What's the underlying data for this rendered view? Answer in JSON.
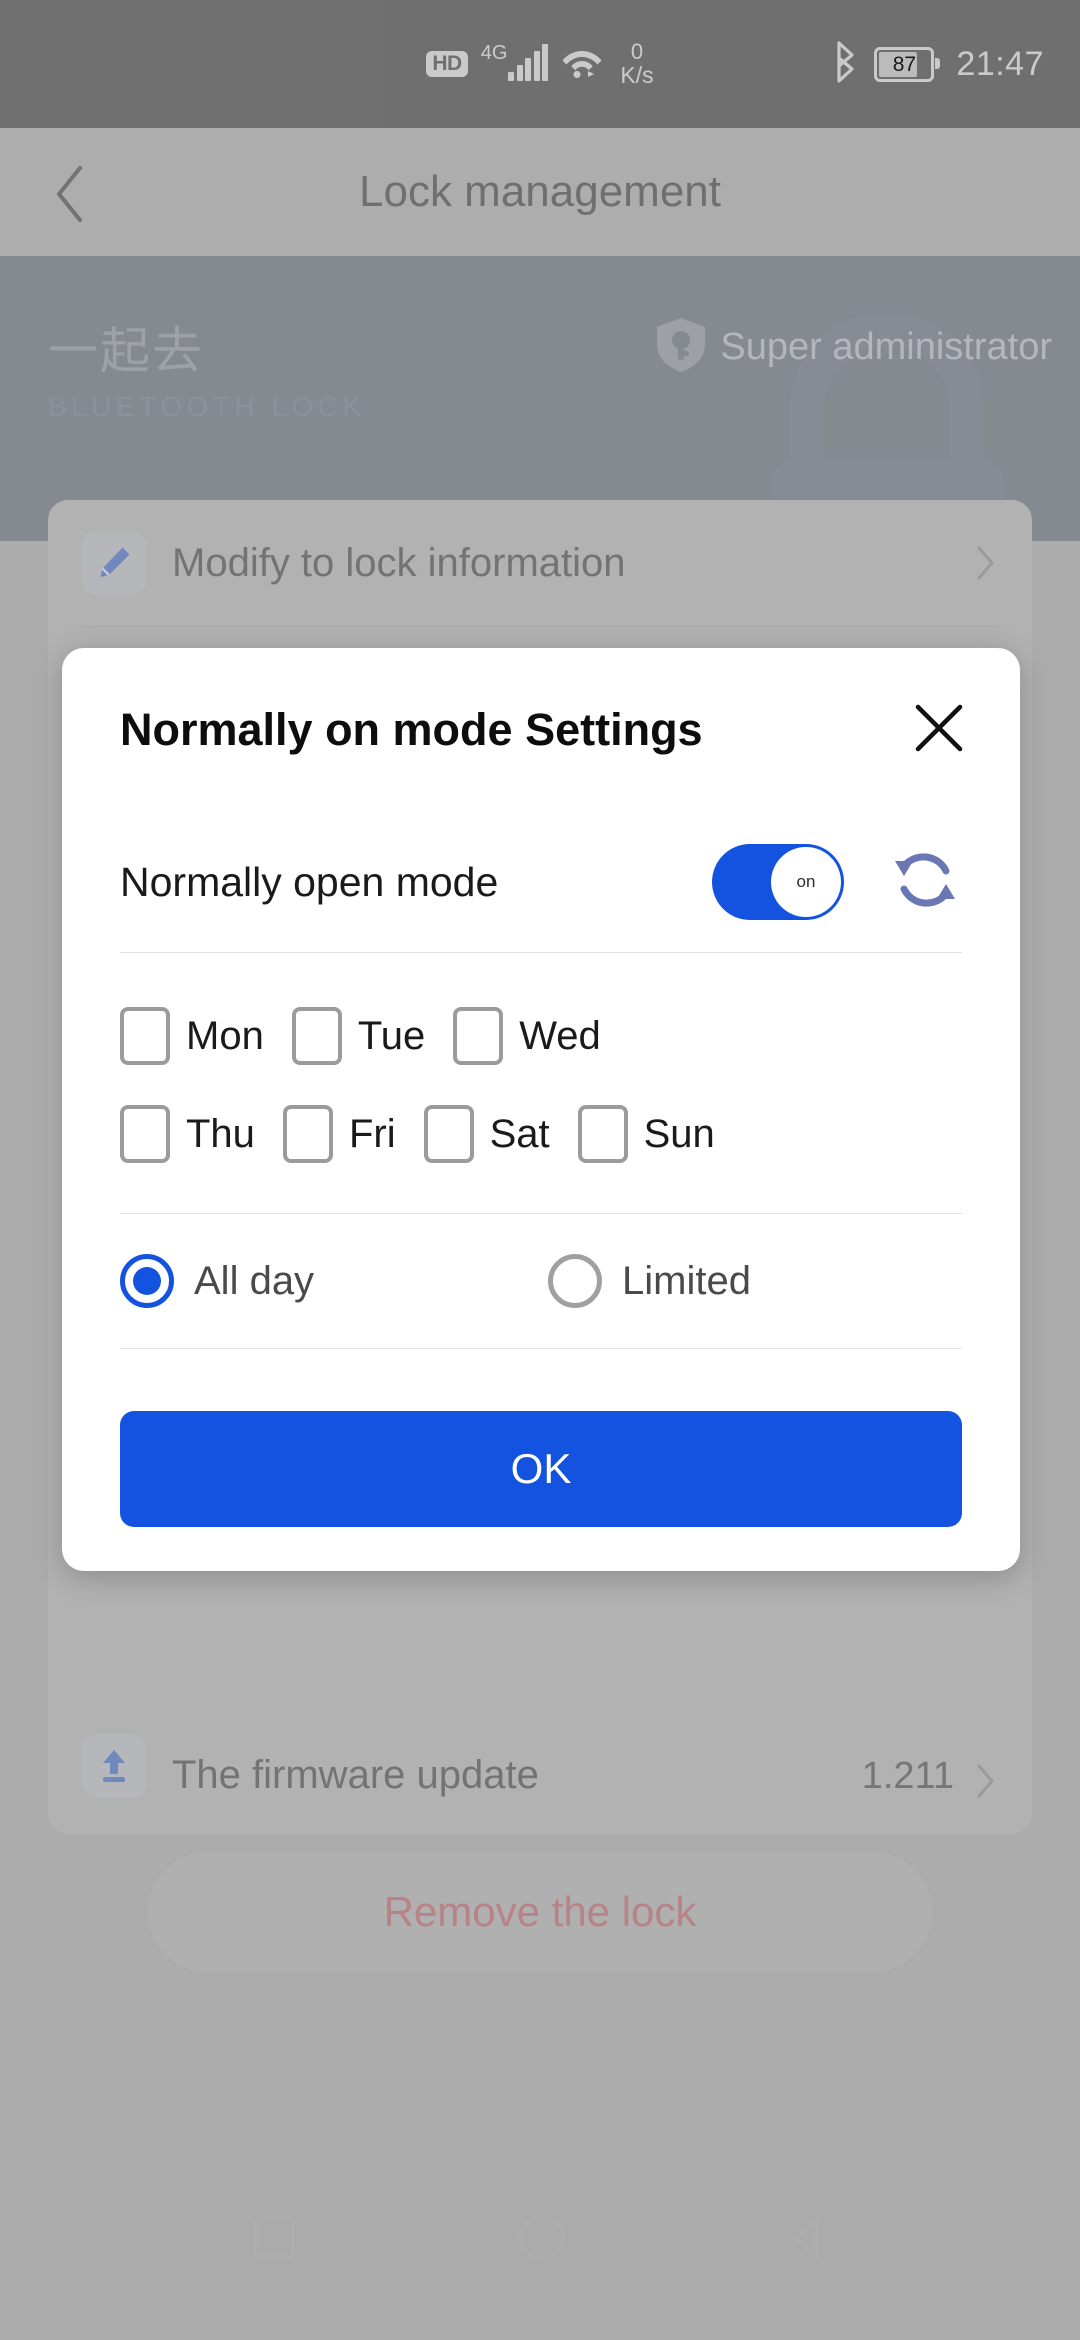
{
  "status_bar": {
    "hd_badge": "HD",
    "network_gen": "4G",
    "net_speed_value": "0",
    "net_speed_unit": "K/s",
    "bluetooth_icon": "bluetooth-icon",
    "battery_percent": "87",
    "time": "21:47"
  },
  "app_bar": {
    "back_icon": "chevron-left-icon",
    "title": "Lock management"
  },
  "banner": {
    "brand_name": "一起去",
    "brand_subtitle": "BLUETOOTH LOCK",
    "role_icon": "shield-key-icon",
    "role_label": "Super administrator",
    "watermark_icon": "lock-icon",
    "background_color": "#4a5568"
  },
  "settings_card": {
    "rows": [
      {
        "icon": "pencil-icon",
        "label": "Modify to lock information",
        "value": "",
        "chevron": "chevron-right-icon"
      },
      {
        "icon": "upload-icon",
        "label": "The firmware update",
        "value": "1.211",
        "chevron": "chevron-right-icon"
      }
    ]
  },
  "remove_lock": {
    "label": "Remove the lock",
    "text_color": "#cf4450"
  },
  "nav_bar": {
    "items": [
      "square-icon",
      "circle-icon",
      "triangle-icon"
    ]
  },
  "modal": {
    "title": "Normally on mode Settings",
    "close_icon": "close-icon",
    "toggle": {
      "label": "Normally open mode",
      "state_label": "on",
      "enabled": true,
      "accent_color": "#1353e0"
    },
    "refresh_icon": "refresh-icon",
    "days": [
      [
        {
          "label": "Mon",
          "checked": false
        },
        {
          "label": "Tue",
          "checked": false
        },
        {
          "label": "Wed",
          "checked": false
        }
      ],
      [
        {
          "label": "Thu",
          "checked": false
        },
        {
          "label": "Fri",
          "checked": false
        },
        {
          "label": "Sat",
          "checked": false
        },
        {
          "label": "Sun",
          "checked": false
        }
      ]
    ],
    "duration_options": [
      {
        "label": "All day",
        "selected": true
      },
      {
        "label": "Limited",
        "selected": false
      }
    ],
    "ok_label": "OK"
  }
}
